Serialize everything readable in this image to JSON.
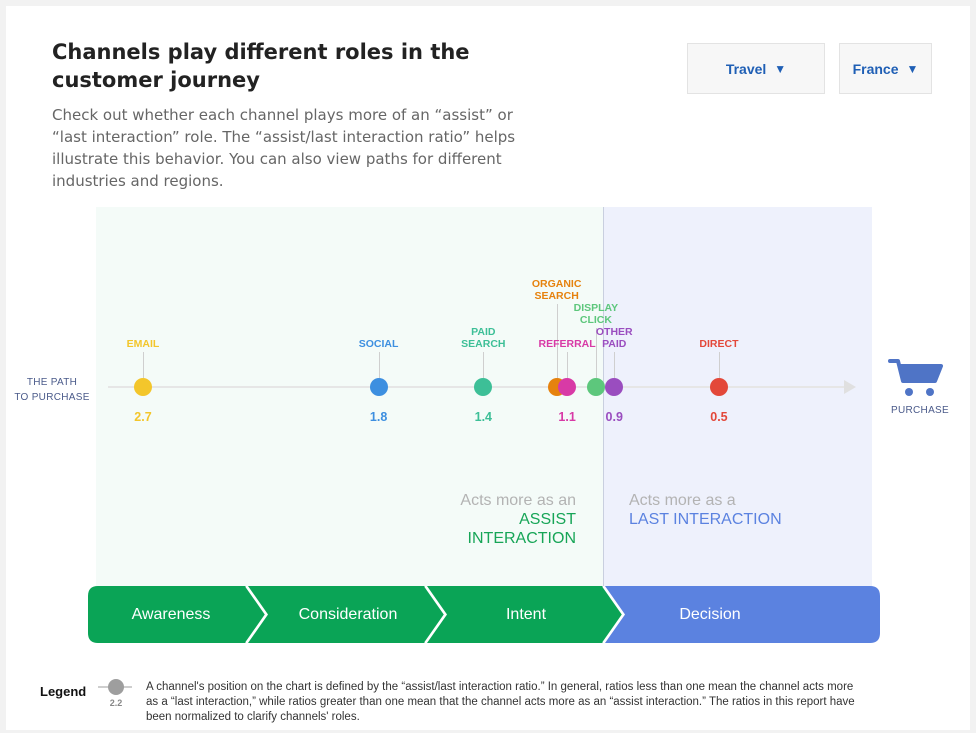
{
  "title": "Channels play different roles in the customer journey",
  "subtitle": "Check out whether each channel plays more of an “assist” or “last interaction” role. The “assist/last interaction ratio” helps illustrate this behavior. You can also view paths for different industries and regions.",
  "filters": {
    "industry": "Travel",
    "region": "France",
    "caret_icon": "triangle-down-icon"
  },
  "path_label": "THE PATH\nTO PURCHASE",
  "purchase_label": "PURCHASE",
  "cart_icon": "shopping-cart-icon",
  "roles": {
    "assist_line1": "Acts more as an",
    "assist_line2": "ASSIST INTERACTION",
    "last_line1": "Acts more as a",
    "last_line2": "LAST INTERACTION"
  },
  "stages": [
    "Awareness",
    "Consideration",
    "Intent",
    "Decision"
  ],
  "legend": {
    "title": "Legend",
    "sample_value": "2.2",
    "text": "A channel's position on the chart is defined by the “assist/last interaction ratio.” In general, ratios less than one mean the channel acts more as a “last interaction,” while ratios greater than one mean that the channel acts more as an “assist interaction.” The ratios in this report have been normalized to clarify channels' roles."
  },
  "colors": {
    "green": "#0aa456",
    "blue": "#5b82e0",
    "email": "#f3c62b",
    "social": "#3d8fe0",
    "paid_search": "#3dbf97",
    "organic_search": "#e6820e",
    "referral": "#d83aa6",
    "display_click": "#5dc77c",
    "other_paid": "#9a4dbf",
    "direct": "#e3483a"
  },
  "chart_data": {
    "type": "scatter",
    "channels": [
      {
        "name": "EMAIL",
        "value": "2.7",
        "ratio": 2.7,
        "color": "#f3c62b",
        "label_level": 0,
        "show_value": true
      },
      {
        "name": "SOCIAL",
        "value": "1.8",
        "ratio": 1.8,
        "color": "#3d8fe0",
        "label_level": 0,
        "show_value": true
      },
      {
        "name": "PAID\nSEARCH",
        "value": "1.4",
        "ratio": 1.4,
        "color": "#3dbf97",
        "label_level": 0,
        "show_value": true
      },
      {
        "name": "ORGANIC\nSEARCH",
        "value": "",
        "ratio": 1.12,
        "color": "#e6820e",
        "label_level": 2,
        "show_value": false
      },
      {
        "name": "REFERRAL",
        "value": "1.1",
        "ratio": 1.08,
        "color": "#d83aa6",
        "label_level": 0,
        "show_value": true
      },
      {
        "name": "DISPLAY\nCLICK",
        "value": "",
        "ratio": 0.97,
        "color": "#5dc77c",
        "label_level": 1,
        "show_value": false
      },
      {
        "name": "OTHER\nPAID",
        "value": "0.9",
        "ratio": 0.9,
        "color": "#9a4dbf",
        "label_level": 0,
        "show_value": true
      },
      {
        "name": "DIRECT",
        "value": "0.5",
        "ratio": 0.5,
        "color": "#e3483a",
        "label_level": 0,
        "show_value": true
      }
    ]
  }
}
